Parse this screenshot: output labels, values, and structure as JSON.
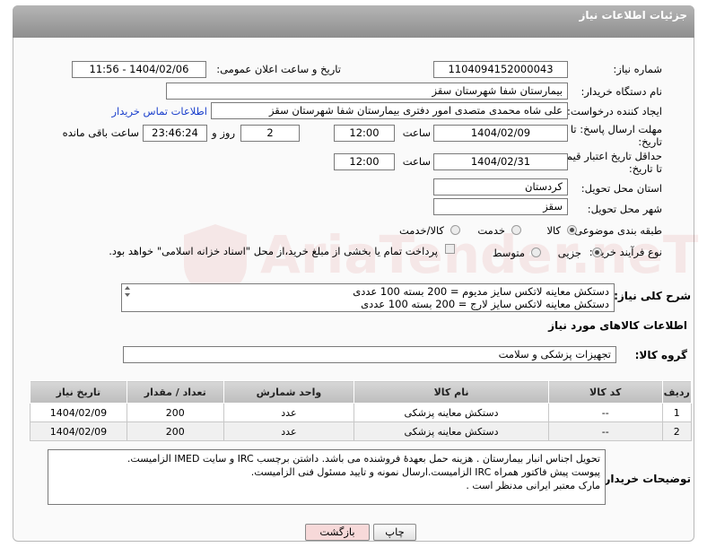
{
  "header": {
    "title": "جزئیات اطلاعات نیاز"
  },
  "fields": {
    "need_number_label": "شماره نیاز:",
    "need_number": "1104094152000043",
    "announce_label": "تاریخ و ساعت اعلان عمومی:",
    "announce_value": "1404/02/06 - 11:56",
    "buyer_org_label": "نام دستگاه خریدار:",
    "buyer_org": "بیمارستان شفا شهرستان سقز",
    "creator_label": "ایجاد کننده درخواست:",
    "creator": "علی شاه محمدی متصدی امور دفتری بیمارستان شفا شهرستان سقز",
    "contact_link": "اطلاعات تماس خریدار",
    "deadline_label_1": "مهلت ارسال پاسخ: تا",
    "deadline_label_2": "تاریخ:",
    "deadline_date": "1404/02/09",
    "time_label": "ساعت",
    "deadline_time": "12:00",
    "days_value": "2",
    "days_label": "روز و",
    "remaining_time": "23:46:24",
    "remaining_label": "ساعت باقی مانده",
    "min_validity_label_1": "حداقل تاریخ اعتبار قیمت:",
    "min_validity_label_2": "تا تاریخ:",
    "validity_date": "1404/02/31",
    "validity_time": "12:00",
    "province_label": "استان محل تحویل:",
    "province": "کردستان",
    "city_label": "شهر محل تحویل:",
    "city": "سقز",
    "category_label": "طبقه بندی موضوعی:",
    "category_options": [
      "کالا",
      "خدمت",
      "کالا/خدمت"
    ],
    "process_label": "نوع فرآیند خرید :",
    "process_options": [
      "جزیی",
      "متوسط"
    ],
    "payment_note": "پرداخت تمام یا بخشی از مبلغ خرید،از محل \"اسناد خزانه اسلامی\" خواهد بود.",
    "general_desc_label": "شرح کلی نیاز:",
    "general_desc_lines": [
      "دستکش معاینه لاتکس سایز مدیوم = 200 بسته 100 عددی",
      "دستکش معاینه لاتکس سایز لارج = 200 بسته 100 عددی"
    ],
    "goods_info_title": "اطلاعات کالاهای مورد نیاز",
    "goods_group_label": "گروه کالا:",
    "goods_group": "تجهیزات پزشکی و سلامت"
  },
  "table": {
    "headers": [
      "ردیف",
      "کد کالا",
      "نام کالا",
      "واحد شمارش",
      "تعداد / مقدار",
      "تاریخ نیاز"
    ],
    "rows": [
      [
        "1",
        "--",
        "دستکش معاینه پزشکی",
        "عدد",
        "200",
        "1404/02/09"
      ],
      [
        "2",
        "--",
        "دستکش معاینه پزشکی",
        "عدد",
        "200",
        "1404/02/09"
      ]
    ]
  },
  "buyer_notes": {
    "label": "توضیحات خریدار:",
    "lines": [
      "تحویل اجناس  انبار بیمارستان . هزینه حمل بعهدهٔ فروشنده می باشد.  داشتن برچسب IRC  و سایت  IMED  الزامیست.",
      "پیوست پیش فاکتور همراه IRC  الزامیست.ارسال نمونه و تایید مسئول فنی الزامیست.",
      "مارک معتبر ایرانی مدنظر است ."
    ]
  },
  "buttons": {
    "print": "چاپ",
    "back": "بازگشت"
  },
  "watermark": "AriaTender.neT",
  "colors": {
    "header": "#9e9e9e",
    "link": "#1a3fcc",
    "back_button_bg": "#f7d9d9"
  }
}
